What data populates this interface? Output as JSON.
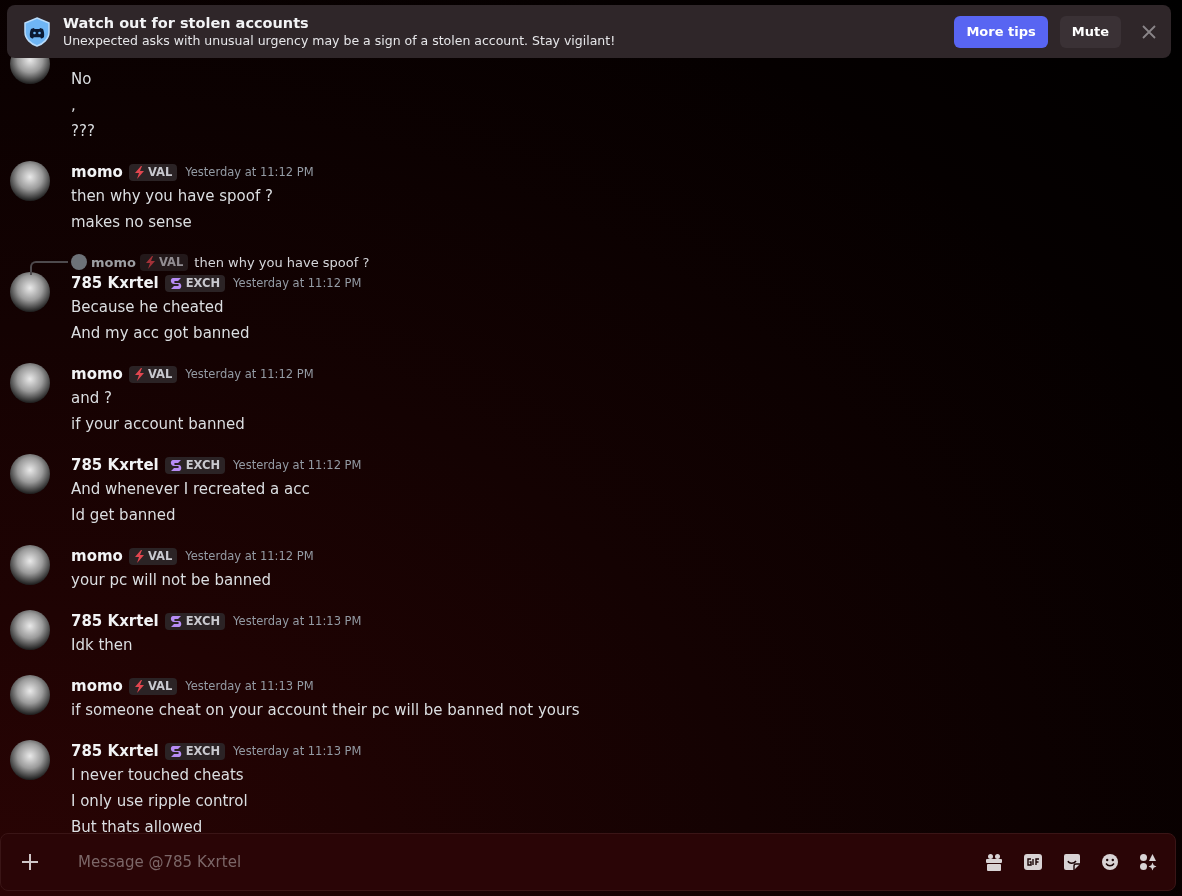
{
  "notice": {
    "title": "Watch out for stolen accounts",
    "body": "Unexpected asks with unusual urgency may be a sign of a stolen account. Stay vigilant!",
    "buttons": [
      {
        "label": "More tips",
        "kind": "primary"
      },
      {
        "label": "Mute",
        "kind": "secondary"
      }
    ]
  },
  "messages": [
    {
      "lines": [
        "No",
        ",",
        "???"
      ]
    },
    {
      "author": "momo",
      "badge": {
        "label": "VAL",
        "kind": "bolt"
      },
      "timestamp": "Yesterday at 11:12 PM",
      "lines": [
        "then why you have spoof ?",
        "makes no sense"
      ]
    },
    {
      "reply": {
        "author": "momo",
        "badge": {
          "label": "VAL",
          "kind": "bolt"
        },
        "text": "then why you have spoof ?"
      },
      "author": "785 Kxrtel",
      "badge": {
        "label": "EXCH",
        "kind": "swirl"
      },
      "timestamp": "Yesterday at 11:12 PM",
      "lines": [
        "Because he cheated",
        "And my acc got banned"
      ]
    },
    {
      "author": "momo",
      "badge": {
        "label": "VAL",
        "kind": "bolt"
      },
      "timestamp": "Yesterday at 11:12 PM",
      "lines": [
        "and ?",
        "if your account banned"
      ]
    },
    {
      "author": "785 Kxrtel",
      "badge": {
        "label": "EXCH",
        "kind": "swirl"
      },
      "timestamp": "Yesterday at 11:12 PM",
      "lines": [
        "And whenever I recreated a acc",
        "Id get banned"
      ]
    },
    {
      "author": "momo",
      "badge": {
        "label": "VAL",
        "kind": "bolt"
      },
      "timestamp": "Yesterday at 11:12 PM",
      "lines": [
        "your pc will not be banned"
      ]
    },
    {
      "author": "785 Kxrtel",
      "badge": {
        "label": "EXCH",
        "kind": "swirl"
      },
      "timestamp": "Yesterday at 11:13 PM",
      "lines": [
        "Idk then"
      ]
    },
    {
      "author": "momo",
      "badge": {
        "label": "VAL",
        "kind": "bolt"
      },
      "timestamp": "Yesterday at 11:13 PM",
      "lines": [
        "if someone cheat on your account their pc will be banned not yours"
      ]
    },
    {
      "author": "785 Kxrtel",
      "badge": {
        "label": "EXCH",
        "kind": "swirl"
      },
      "timestamp": "Yesterday at 11:13 PM",
      "lines": [
        "I never touched cheats",
        "I only use ripple control",
        "But thats allowed"
      ]
    }
  ],
  "composer": {
    "placeholder": "Message @785 Kxrtel"
  }
}
